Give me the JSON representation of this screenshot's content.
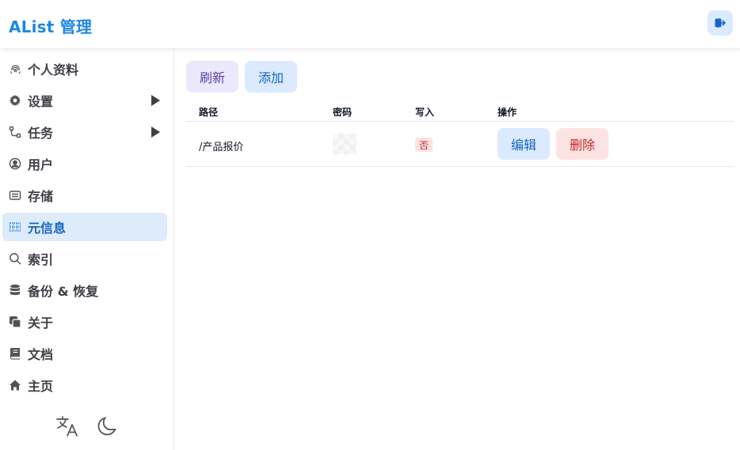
{
  "header": {
    "title": "AList 管理",
    "logout_icon": "logout-icon"
  },
  "sidebar": {
    "items": [
      {
        "label": "个人资料",
        "icon": "fingerprint-icon",
        "active": false,
        "has_arrow": false
      },
      {
        "label": "设置",
        "icon": "gear-icon",
        "active": false,
        "has_arrow": true
      },
      {
        "label": "任务",
        "icon": "flow-icon",
        "active": false,
        "has_arrow": true
      },
      {
        "label": "用户",
        "icon": "user-circle-icon",
        "active": false,
        "has_arrow": false
      },
      {
        "label": "存储",
        "icon": "storage-icon",
        "active": false,
        "has_arrow": false
      },
      {
        "label": "元信息",
        "icon": "metadata-icon",
        "active": true,
        "has_arrow": false
      },
      {
        "label": "索引",
        "icon": "search-icon",
        "active": false,
        "has_arrow": false
      },
      {
        "label": "备份 & 恢复",
        "icon": "database-icon",
        "active": false,
        "has_arrow": false
      },
      {
        "label": "关于",
        "icon": "copy-icon",
        "active": false,
        "has_arrow": false
      },
      {
        "label": "文档",
        "icon": "book-icon",
        "active": false,
        "has_arrow": false
      },
      {
        "label": "主页",
        "icon": "home-icon",
        "active": false,
        "has_arrow": false
      }
    ],
    "bottom": {
      "language_icon": "translate-icon",
      "theme_icon": "moon-icon"
    }
  },
  "toolbar": {
    "refresh_label": "刷新",
    "add_label": "添加"
  },
  "table": {
    "columns": [
      "路径",
      "密码",
      "写入",
      "操作"
    ],
    "rows": [
      {
        "path": "/产品报价",
        "write": "否",
        "edit_label": "编辑",
        "delete_label": "删除"
      }
    ]
  },
  "colors": {
    "accent": "#1e88e5",
    "active_bg": "#ddebfb",
    "danger": "#c62828",
    "danger_bg": "#fde2e2",
    "refresh_bg": "#ece8fb"
  }
}
